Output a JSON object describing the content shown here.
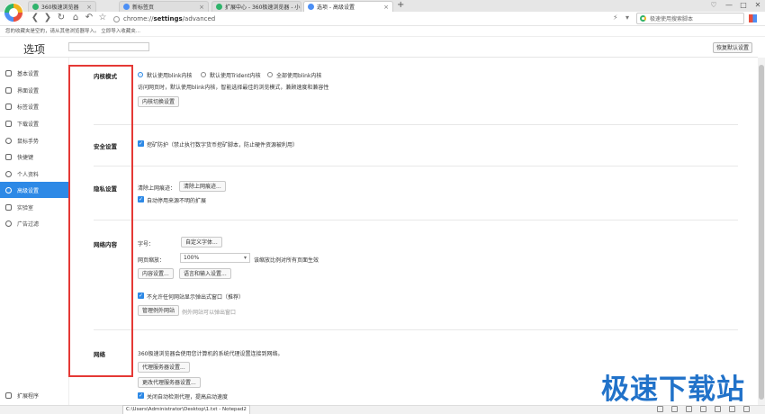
{
  "tabs": [
    {
      "label": "360极速浏览器",
      "color": "#2fb36b"
    },
    {
      "label": "新标签页",
      "color": "#4c8ff5"
    },
    {
      "label": "扩展中心 - 360极速浏览器 - 小...",
      "color": "#2fb36b"
    },
    {
      "label": "选项 - 高级设置",
      "color": "#4c8ff5"
    }
  ],
  "tab_close": "×",
  "new_tab": "+",
  "window_controls": {
    "shirt": "♡",
    "minimize": "—",
    "maximize": "□",
    "close": "✕"
  },
  "nav": {
    "back": "❮",
    "forward": "❯",
    "reload": "↻",
    "home": "⌂",
    "undo": "↶",
    "star": "☆"
  },
  "address": {
    "prefix": "chrome://",
    "host": "settings",
    "path": "/advanced"
  },
  "toolbar_icons": {
    "lightning": "⚡",
    "dropdown": "▾"
  },
  "search": {
    "placeholder": "极速使用搜索脚本"
  },
  "bookmark_bar": "您的收藏夹是空的，请从其他浏览器导入。 立即导入收藏夹...",
  "page": {
    "title": "选项",
    "restore_button": "恢复默认设置"
  },
  "sidebar": {
    "items": [
      {
        "label": "基本设置",
        "active": false
      },
      {
        "label": "界面设置",
        "active": false
      },
      {
        "label": "标签设置",
        "active": false
      },
      {
        "label": "下载设置",
        "active": false
      },
      {
        "label": "鼠标手势",
        "active": false
      },
      {
        "label": "快捷键",
        "active": false
      },
      {
        "label": "个人资料",
        "active": false
      },
      {
        "label": "高级设置",
        "active": true
      },
      {
        "label": "实验室",
        "active": false
      },
      {
        "label": "广告过滤",
        "active": false
      }
    ],
    "extensions": "扩展程序"
  },
  "sections": {
    "kernel": {
      "title": "内核模式",
      "options": [
        "默认使用blink内核",
        "默认使用Trident内核",
        "全部使用blink内核"
      ],
      "selected": 0,
      "desc": "访问网页时，默认使用blink内核，智能选择最佳的浏览模式，兼顾速度和兼容性",
      "button": "内核切换设置"
    },
    "security": {
      "title": "安全设置",
      "checkbox": "挖矿防护（禁止执行数字货币挖矿脚本，防止硬件资源被利用）"
    },
    "privacy": {
      "title": "隐私设置",
      "clear_label": "清除上网痕迹：",
      "clear_button": "清除上网痕迹...",
      "checkbox": "自动停用来源不明的扩展"
    },
    "web_content": {
      "title": "网络内容",
      "font_label": "字号：",
      "font_button": "自定义字体...",
      "zoom_label": "网页缩放：",
      "zoom_value": "100%",
      "zoom_desc": "该缩放比例对所有页面生效",
      "content_button": "内容设置...",
      "lang_button": "语言和输入设置...",
      "popup_checkbox": "不允许任何网站显示弹出式窗口（推荐）",
      "exceptions_button": "管理例外网站",
      "exceptions_desc": "例外网站可以弹出窗口"
    },
    "network": {
      "title": "网络",
      "desc": "360极速浏览器会使用您计算机的系统代理设置连接到网络。",
      "proxy_button": "代理服务器设置...",
      "change_proxy_button": "更改代理服务器设置...",
      "checkbox": "关闭自动检测代理，提高启动速度"
    }
  },
  "status": {
    "text": "C:\\Users\\Administrator\\Desktop\\1.txt - Notepad2"
  },
  "watermark": "极速下载站",
  "colors": {
    "accent": "#2d89e6",
    "highlight_box": "#e53935",
    "watermark": "#2172c9"
  }
}
